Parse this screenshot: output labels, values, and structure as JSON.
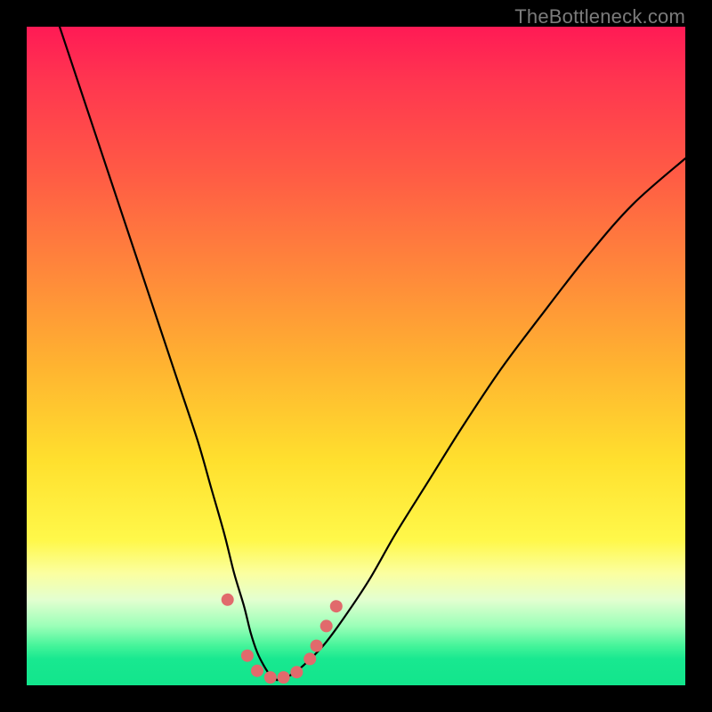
{
  "watermark": "TheBottleneck.com",
  "colors": {
    "page_bg": "#000000",
    "watermark": "#7b7b7b",
    "curve": "#000000",
    "marker": "#e16a6c",
    "gradient_top": "#ff1a55",
    "gradient_mid": "#ffe02e",
    "gradient_bottom": "#12e58c"
  },
  "chart_data": {
    "type": "line",
    "title": "",
    "xlabel": "",
    "ylabel": "",
    "xlim": [
      0,
      100
    ],
    "ylim": [
      0,
      100
    ],
    "grid": false,
    "legend": false,
    "series": [
      {
        "name": "left-branch",
        "x": [
          5,
          8,
          11,
          14,
          17,
          20,
          23,
          26,
          28,
          30,
          31.5,
          33,
          34,
          35,
          36,
          37,
          38
        ],
        "y": [
          100,
          91,
          82,
          73,
          64,
          55,
          46,
          37,
          30,
          23,
          17,
          12,
          8,
          5,
          3,
          1.5,
          0.8
        ]
      },
      {
        "name": "right-branch",
        "x": [
          38,
          40,
          42,
          45,
          48,
          52,
          56,
          61,
          66,
          72,
          78,
          85,
          92,
          100
        ],
        "y": [
          0.8,
          1.5,
          3,
          6,
          10,
          16,
          23,
          31,
          39,
          48,
          56,
          65,
          73,
          80
        ]
      }
    ],
    "markers": {
      "name": "highlight-points",
      "x": [
        30.5,
        33.5,
        35,
        37,
        39,
        41,
        43,
        44,
        45.5,
        47
      ],
      "y": [
        13,
        4.5,
        2.2,
        1.2,
        1.2,
        2,
        4,
        6,
        9,
        12
      ]
    }
  }
}
